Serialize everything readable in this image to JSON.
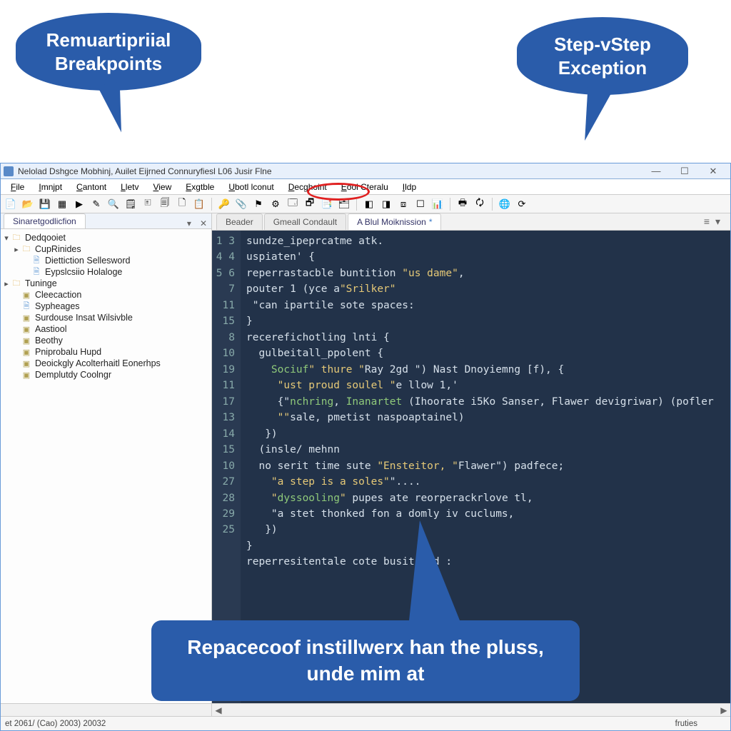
{
  "callouts": {
    "left": "Remuartipriial Breakpoints",
    "right": "Step-vStep Exception",
    "bottom": "Repacecoof instillwerx han the pluss, unde mim at"
  },
  "window": {
    "title": "Nelolad Dshgce Mobhinj, Auilet Eijrned Connuryfiesl L06 Jusir Flne"
  },
  "menu": {
    "items": [
      "File",
      "Imnjpt",
      "Cantont",
      "Lletv",
      "View",
      "Exgtble",
      "Ubotl lconut",
      "Decghoint",
      "Eool Cteralu",
      "Ildp"
    ]
  },
  "sidebar": {
    "tab": "Sinaretgodlicfion",
    "items": [
      {
        "exp": "▾",
        "depth": 0,
        "icon": "folder",
        "label": "Dedqooiet"
      },
      {
        "exp": "▸",
        "depth": 1,
        "icon": "folder",
        "label": "CupRinides"
      },
      {
        "exp": "",
        "depth": 2,
        "icon": "page",
        "label": "Diettiction Sellesword"
      },
      {
        "exp": "",
        "depth": 2,
        "icon": "page",
        "label": "Eypslcsiio Holaloge"
      },
      {
        "exp": "▸",
        "depth": 0,
        "icon": "folder",
        "label": "Tuninge"
      },
      {
        "exp": "",
        "depth": 1,
        "icon": "box",
        "label": "Cleecaction"
      },
      {
        "exp": "",
        "depth": 1,
        "icon": "page",
        "label": "Sypheages"
      },
      {
        "exp": "",
        "depth": 1,
        "icon": "box",
        "label": "Surdouse Insat Wilsivble"
      },
      {
        "exp": "",
        "depth": 1,
        "icon": "box",
        "label": "Aastiool"
      },
      {
        "exp": "",
        "depth": 1,
        "icon": "box",
        "label": "Beothy"
      },
      {
        "exp": "",
        "depth": 1,
        "icon": "box",
        "label": "Pniprobalu Hupd"
      },
      {
        "exp": "",
        "depth": 1,
        "icon": "box",
        "label": "Deoickgly Acolterhaitl Eonerhps"
      },
      {
        "exp": "",
        "depth": 1,
        "icon": "box",
        "label": "Demplutdy Coolngr"
      }
    ]
  },
  "editor": {
    "tabs": [
      "Beader",
      "Gmeall Condault",
      "A Blul Moiknission"
    ],
    "active_tab_star": "*",
    "gutter": [
      "1",
      "3",
      "4",
      "4",
      "5",
      "6",
      "7",
      "11",
      "15",
      "8",
      "10",
      "19",
      "11",
      "17",
      "13",
      "14",
      "15",
      "10",
      "27",
      "28",
      "29",
      "25"
    ]
  },
  "code_lines": [
    {
      "t": "sundze_ipeprcatme atk."
    },
    {
      "t": "uspiaten' {"
    },
    {
      "t": "reperrastacble buntition \"us dame\","
    },
    {
      "t": "pouter 1 (yce a\"Srilker\""
    },
    {
      "t": " \"can ipartile sote spaces:"
    },
    {
      "t": "}"
    },
    {
      "t": "recerefichotling lnti {"
    },
    {
      "t": "  gulbeitall_ppolent {"
    },
    {
      "t": "    Sociuf\" thure \"Ray 2gd \") Nast Dnoyiemng [f), {"
    },
    {
      "t": "     \"ust proud soulel \"e llow 1,'"
    },
    {
      "t": "     {\"nchring, Inanartet (Ihoorate i5Ko Sanser, Flawer devigriwar) (pofler"
    },
    {
      "t": "     \"\"sale, pmetist naspoaptainel)"
    },
    {
      "t": "   })"
    },
    {
      "t": "  (insle/ mehnn"
    },
    {
      "t": "  no serit time sute \"Ensteitor, \"Flawer\") padfece;"
    },
    {
      "t": "    \"a step is a soles\"\"...."
    },
    {
      "t": "    \"dyssooling\" pupes ate reorperackrlove tl,"
    },
    {
      "t": "    \"a stet thonked fon a domly iv cuclums,"
    },
    {
      "t": "   })"
    },
    {
      "t": "}"
    },
    {
      "t": "reperresitentale cote busitiond :"
    },
    {
      "t": ""
    }
  ],
  "status": {
    "left": "et 2061/ (Cao) 2003) 20032",
    "right": "fruties"
  },
  "icons": {
    "tb": [
      "📄",
      "📂",
      "💾",
      "▦",
      "▶",
      "✎",
      "🔍",
      "🗒",
      "🗉",
      "🗐",
      "🗋",
      "📋",
      "|",
      "🔑",
      "📎",
      "⚑",
      "⚙",
      "🗔",
      "🗗",
      "📑",
      "🗂",
      "|",
      "◧",
      "◨",
      "⧈",
      "☐",
      "📊",
      "|",
      "🖶",
      "🗘",
      "|",
      "🌐",
      "⟳"
    ]
  }
}
